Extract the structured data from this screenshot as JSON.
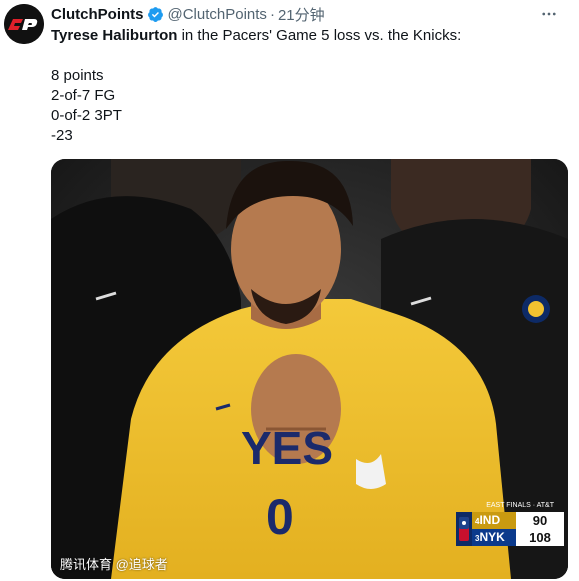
{
  "author": {
    "display_name": "ClutchPoints",
    "handle": "@ClutchPoints",
    "separator": "·",
    "time": "21分钟",
    "avatar_icon": "clutchpoints-logo-icon",
    "verified_icon": "verified-badge-icon"
  },
  "tweet": {
    "player_name": "Tyrese Haliburton",
    "headline_rest": " in the Pacers' Game 5 loss vs. the Knicks:",
    "stats": [
      "8 points",
      "2-of-7 FG",
      "0-of-2 3PT",
      "-23"
    ]
  },
  "media": {
    "series_label": "EAST FINALS · AT&T",
    "scoreboard": [
      {
        "seed": "4",
        "team": "IND",
        "score": "90"
      },
      {
        "seed": "3",
        "team": "NYK",
        "score": "108"
      }
    ],
    "watermark": "腾讯体育 @追球者"
  },
  "colors": {
    "verified": "#1d9bf0",
    "jersey": "#f2c230",
    "ind": "#c99a10",
    "nyk": "#0b3a8c"
  }
}
